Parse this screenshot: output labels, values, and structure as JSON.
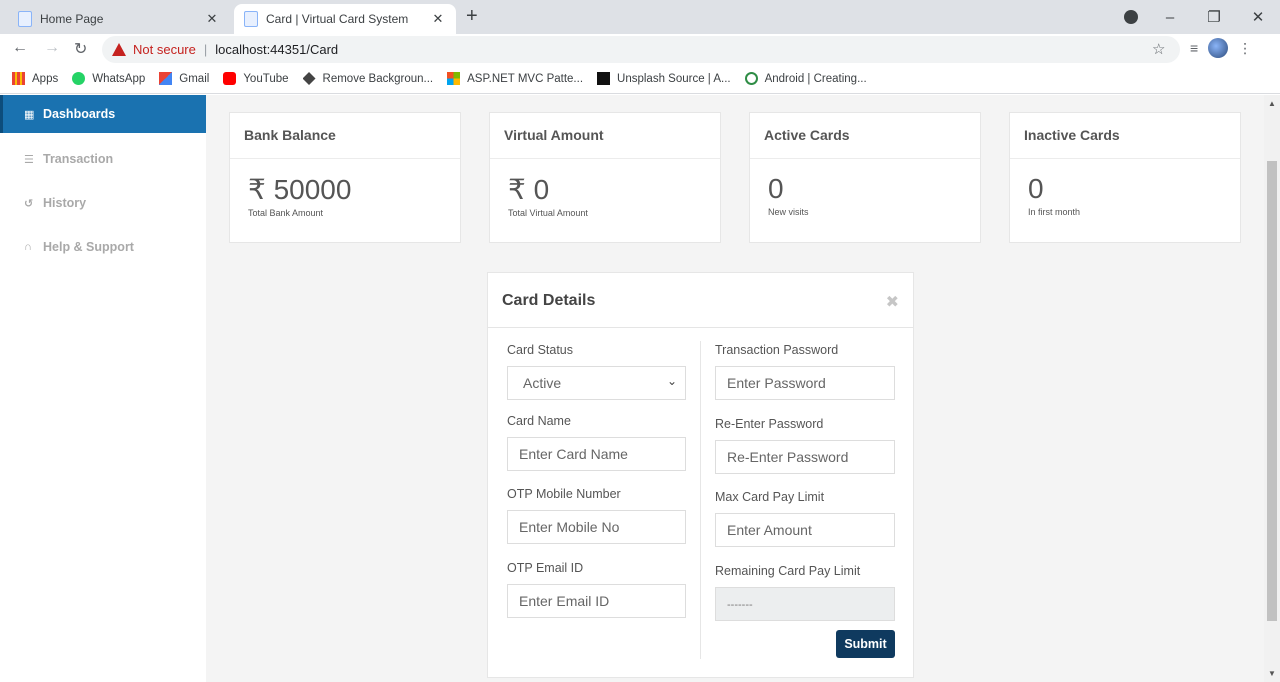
{
  "browser": {
    "tabs": [
      {
        "title": "Home Page"
      },
      {
        "title": "Card | Virtual Card System"
      }
    ],
    "security_label": "Not secure",
    "url": "localhost:44351/Card",
    "bookmarks": [
      "Apps",
      "WhatsApp",
      "Gmail",
      "YouTube",
      "Remove Backgroun...",
      "ASP.NET MVC Patte...",
      "Unsplash Source | A...",
      "Android | Creating..."
    ]
  },
  "sidebar": {
    "items": [
      {
        "label": "Dashboards",
        "icon": "grid-icon"
      },
      {
        "label": "Transaction",
        "icon": "list-icon"
      },
      {
        "label": "History",
        "icon": "history-icon"
      },
      {
        "label": "Help & Support",
        "icon": "support-icon"
      }
    ]
  },
  "stats": [
    {
      "title": "Bank Balance",
      "value": "₹ 50000",
      "caption": "Total Bank Amount"
    },
    {
      "title": "Virtual Amount",
      "value": "₹ 0",
      "caption": "Total Virtual Amount"
    },
    {
      "title": "Active Cards",
      "value": "0",
      "caption": "New visits"
    },
    {
      "title": "Inactive Cards",
      "value": "0",
      "caption": "In first month"
    }
  ],
  "card_details": {
    "title": "Card Details",
    "close_glyph": "✖",
    "card_status": {
      "label": "Card Status",
      "value": "Active"
    },
    "card_name": {
      "label": "Card Name",
      "placeholder": "Enter Card Name"
    },
    "otp_mobile": {
      "label": "OTP Mobile Number",
      "placeholder": "Enter Mobile No"
    },
    "otp_email": {
      "label": "OTP Email ID",
      "placeholder": "Enter Email ID"
    },
    "transaction_password": {
      "label": "Transaction Password",
      "placeholder": "Enter Password"
    },
    "reenter_password": {
      "label": "Re-Enter Password",
      "placeholder": "Re-Enter Password"
    },
    "max_limit": {
      "label": "Max Card Pay Limit",
      "placeholder": "Enter Amount"
    },
    "remaining_limit": {
      "label": "Remaining Card Pay Limit",
      "value": "-------"
    },
    "submit_label": "Submit"
  }
}
